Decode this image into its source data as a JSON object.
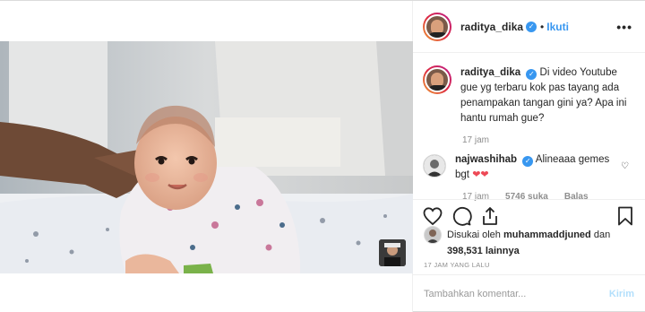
{
  "post": {
    "author": "raditya_dika",
    "follow_label": "Ikuti",
    "more_label": "•••",
    "caption": {
      "username": "raditya_dika",
      "text": "Di video Youtube gue yg terbaru kok pas tayang ada penampakan tangan gini ya? Apa ini hantu rumah gue?",
      "age": "17 jam"
    },
    "comment": {
      "username": "najwashihab",
      "text": "Alineaaa gemes bgt",
      "emoji": "❤❤",
      "age": "17 jam",
      "likes": "5746 suka",
      "reply_label": "Balas"
    },
    "likes": {
      "prefix": "Disukai oleh",
      "liker": "muhammaddjuned",
      "connector": "dan",
      "count": "398,531 lainnya"
    },
    "timestamp": "17 JAM YANG LALU",
    "add_comment": {
      "placeholder": "Tambahkan komentar...",
      "send_label": "Kirim"
    }
  },
  "icons": {
    "verified": "verified-badge-icon",
    "like": "heart-outline-icon",
    "comment": "comment-bubble-icon",
    "share": "share-upload-icon",
    "save": "bookmark-icon",
    "comment_like": "small-heart-icon"
  },
  "colors": {
    "link_blue": "#3897f0",
    "send_disabled": "#b2dffc",
    "muted": "#8e8e8e",
    "heart_red": "#ed4956"
  }
}
